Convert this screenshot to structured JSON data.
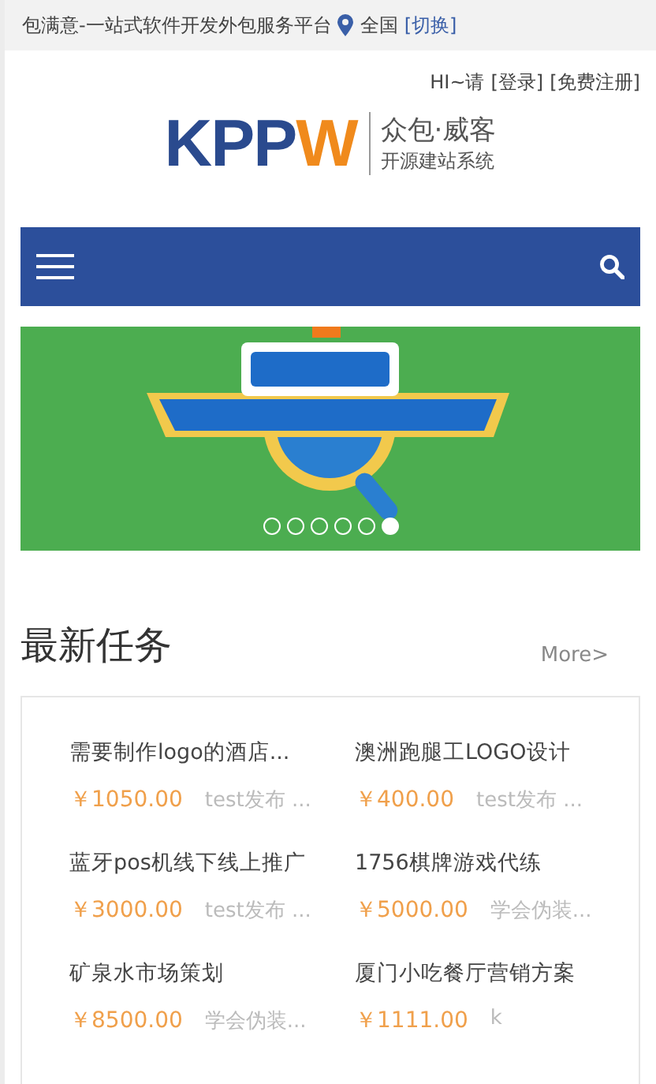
{
  "top_bar": {
    "slogan": "包满意-一站式软件开发外包服务平台",
    "location": "全国",
    "switch_link": "[切换]"
  },
  "user_bar": {
    "greeting": "HI~请",
    "login": "[登录]",
    "register": "[免费注册]"
  },
  "logo": {
    "mark": "KPPW",
    "name": "众包·威客",
    "tagline": "开源建站系统"
  },
  "banner": {
    "kind": "picture",
    "dots": [
      {
        "selected": false
      },
      {
        "selected": false
      },
      {
        "selected": false
      },
      {
        "selected": false
      },
      {
        "selected": false
      },
      {
        "selected": true
      }
    ]
  },
  "section": {
    "title": "最新任务",
    "more": "More>"
  },
  "tasks": [
    {
      "title": "需要制作logo的酒店...",
      "price": "￥1050.00",
      "publisher": "test发布 ..."
    },
    {
      "title": "澳洲跑腿工LOGO设计",
      "price": "￥400.00",
      "publisher": "test发布 ..."
    },
    {
      "title": "蓝牙pos机线下线上推广",
      "price": "￥3000.00",
      "publisher": "test发布 ..."
    },
    {
      "title": "1756棋牌游戏代练",
      "price": "￥5000.00",
      "publisher": "学会伪装..."
    },
    {
      "title": "矿泉水市场策划",
      "price": "￥8500.00",
      "publisher": "学会伪装..."
    },
    {
      "title": "厦门小吃餐厅营销方案",
      "price": "￥1111.00",
      "publisher": "k"
    }
  ]
}
